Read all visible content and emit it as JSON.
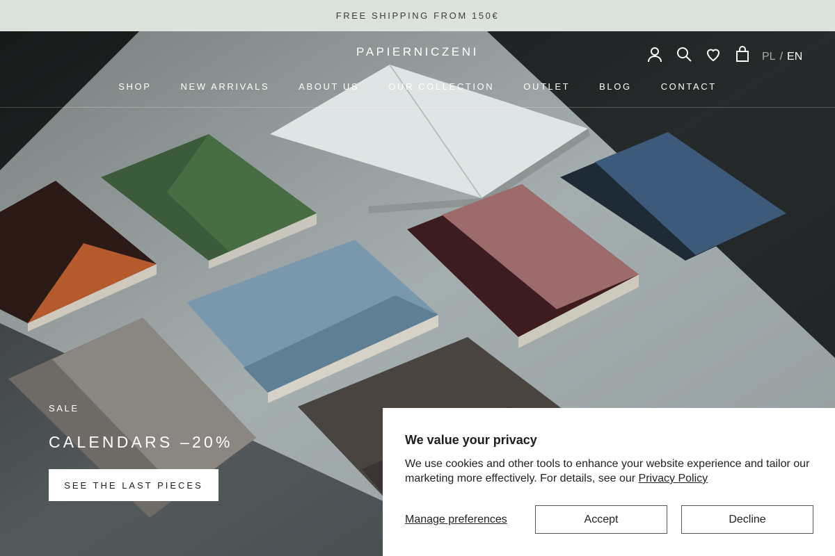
{
  "announcement": "FREE SHIPPING FROM 150€",
  "brand": {
    "logo": "PAPIERNICZENI"
  },
  "header_icons": [
    "account-icon",
    "search-icon",
    "wishlist-heart-icon",
    "cart-bag-icon"
  ],
  "language": {
    "inactive": "PL",
    "separator": "/",
    "active": "EN"
  },
  "nav": [
    "SHOP",
    "NEW ARRIVALS",
    "ABOUT US",
    "OUR COLLECTION",
    "OUTLET",
    "BLOG",
    "CONTACT"
  ],
  "promo": {
    "eyebrow": "SALE",
    "headline": "CALENDARS –20%",
    "cta": "SEE THE LAST PIECES"
  },
  "cookie": {
    "title": "We value your privacy",
    "body": "We use cookies and other tools to enhance your website experience and tailor our marketing more effectively. For details, see our ",
    "policy_link": "Privacy Policy",
    "manage": "Manage preferences",
    "accept": "Accept",
    "decline": "Decline"
  },
  "colors": {
    "announcement_bg": "#dbe3dc",
    "hero_bg": "#2a2d2c",
    "text_light": "#ffffff",
    "text_dark": "#1c1d1d"
  }
}
